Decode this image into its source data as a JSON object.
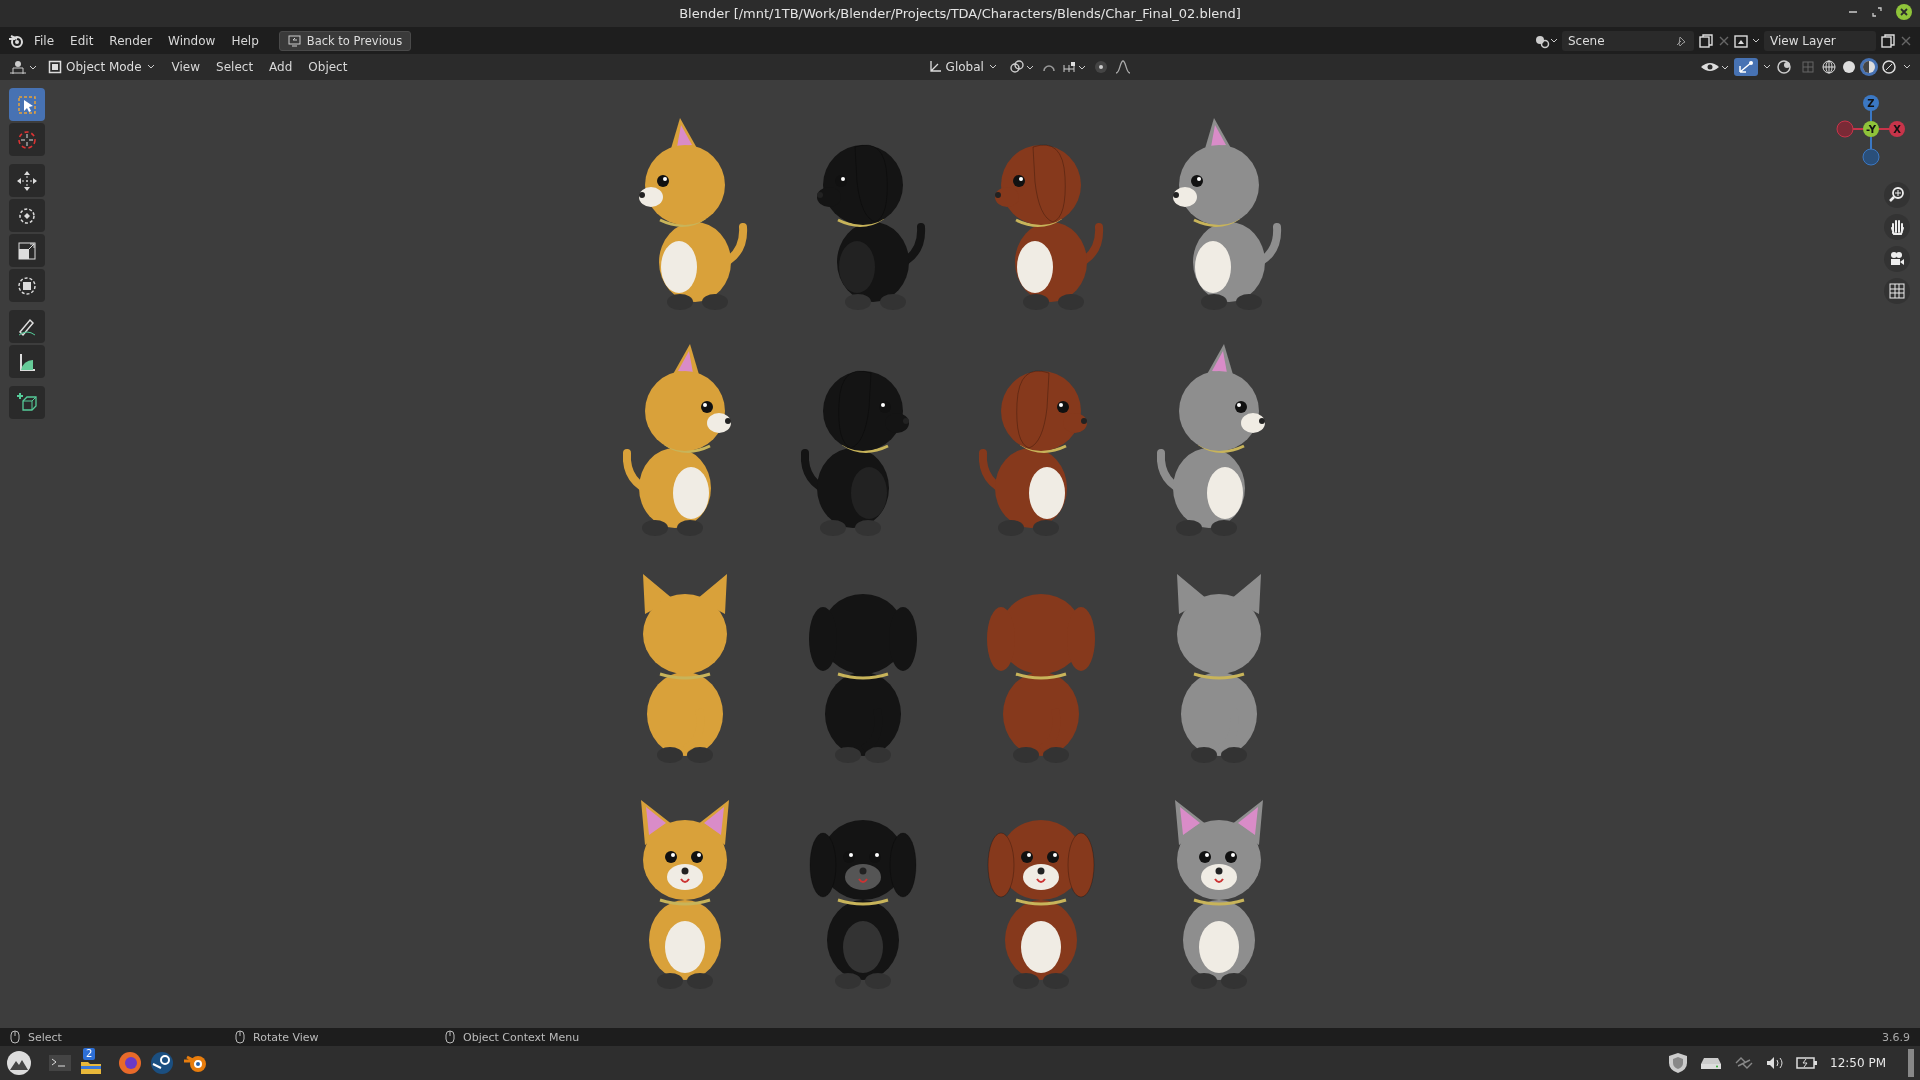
{
  "window": {
    "title": "Blender [/mnt/1TB/Work/Blender/Projects/TDA/Characters/Blends/Char_Final_02.blend]"
  },
  "menu_bar": {
    "items": [
      "File",
      "Edit",
      "Render",
      "Window",
      "Help"
    ],
    "back_button": "Back to Previous"
  },
  "workspace": {
    "scene": "Scene",
    "view_layer": "View Layer"
  },
  "header": {
    "mode": "Object Mode",
    "menus": [
      "View",
      "Select",
      "Add",
      "Object"
    ],
    "orientation": "Global",
    "shading": [
      {
        "kind": "wireframe",
        "selected": false
      },
      {
        "kind": "solid",
        "selected": false
      },
      {
        "kind": "material",
        "selected": true
      },
      {
        "kind": "rendered",
        "selected": false
      }
    ]
  },
  "toolbar": {
    "tools": [
      {
        "kind": "select",
        "selected": true
      },
      {
        "kind": "cursor",
        "selected": false
      },
      {
        "kind": "move",
        "selected": false
      },
      {
        "kind": "rotate",
        "selected": false
      },
      {
        "kind": "scale",
        "selected": false
      },
      {
        "kind": "transform",
        "selected": false
      },
      {
        "kind": "annotate",
        "selected": false
      },
      {
        "kind": "measure",
        "selected": false
      },
      {
        "kind": "add-cube",
        "selected": false
      }
    ]
  },
  "gizmo": {
    "z": "Z",
    "y": "-Y",
    "x": "X"
  },
  "models": {
    "columns": [
      {
        "kind": "cat",
        "color": "#d9a13a"
      },
      {
        "kind": "dog",
        "color": "#141414"
      },
      {
        "kind": "dog",
        "color": "#86391c"
      },
      {
        "kind": "cat",
        "color": "#8e8e8e"
      }
    ],
    "views": [
      {
        "kind": "left"
      },
      {
        "kind": "right"
      },
      {
        "kind": "back"
      },
      {
        "kind": "front"
      }
    ]
  },
  "status_bar": {
    "hints": [
      "Select",
      "Rotate View",
      "Object Context Menu"
    ],
    "version": "3.6.9"
  },
  "taskbar": {
    "badge": "2",
    "clock": "12:50 PM"
  }
}
